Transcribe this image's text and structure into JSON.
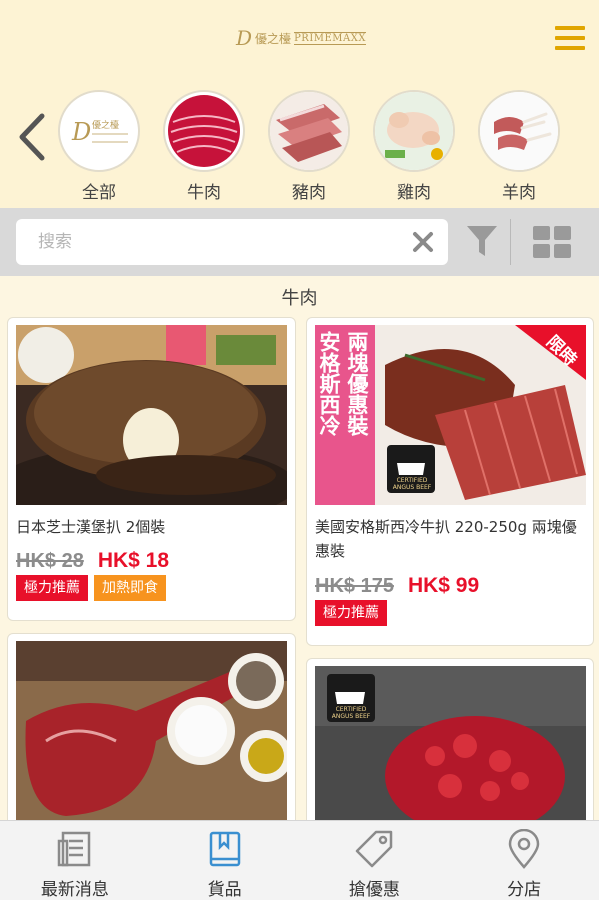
{
  "header": {
    "logo_mark": "D",
    "logo_cn": "優之檯",
    "logo_en": "PRIMEMAXX"
  },
  "categories": [
    {
      "label": "全部",
      "icon": "brand-logo-icon"
    },
    {
      "label": "牛肉",
      "icon": "beef-slices-icon"
    },
    {
      "label": "豬肉",
      "icon": "pork-icon"
    },
    {
      "label": "雞肉",
      "icon": "chicken-icon"
    },
    {
      "label": "羊肉",
      "icon": "lamb-rack-icon"
    }
  ],
  "search": {
    "placeholder": "搜索",
    "value": ""
  },
  "section": {
    "title": "牛肉"
  },
  "products": [
    {
      "name": "日本芝士漢堡扒 2個裝",
      "old_price": "HK$ 28",
      "new_price": "HK$ 18",
      "tags": [
        "極力推薦",
        "加熱即食"
      ]
    },
    {
      "name": "美國安格斯西冷牛扒 220-250g 兩塊優惠裝",
      "old_price": "HK$ 175",
      "new_price": "HK$ 99",
      "tags": [
        "極力推薦"
      ],
      "banner_text": [
        "安格斯西冷",
        "兩塊優惠裝"
      ],
      "ribbon": "限時",
      "badge_text": "CERTIFIED ANGUS BEEF"
    },
    {
      "name": "",
      "image": "tomahawk-steak"
    },
    {
      "name": "",
      "image": "minced-beef",
      "badge_text": "CERTIFIED ANGUS BEEF"
    }
  ],
  "bottom_nav": [
    {
      "label": "最新消息",
      "icon": "news-icon",
      "active": false
    },
    {
      "label": "貨品",
      "icon": "book-icon",
      "active": true
    },
    {
      "label": "搶優惠",
      "icon": "tag-icon",
      "active": false
    },
    {
      "label": "分店",
      "icon": "location-pin-icon",
      "active": false
    }
  ],
  "colors": {
    "accent": "#e0a500",
    "price_red": "#e8102a",
    "tag_orange": "#f7931e",
    "active_nav": "#3a8fd0",
    "header_bg": "#fdf3d4"
  }
}
